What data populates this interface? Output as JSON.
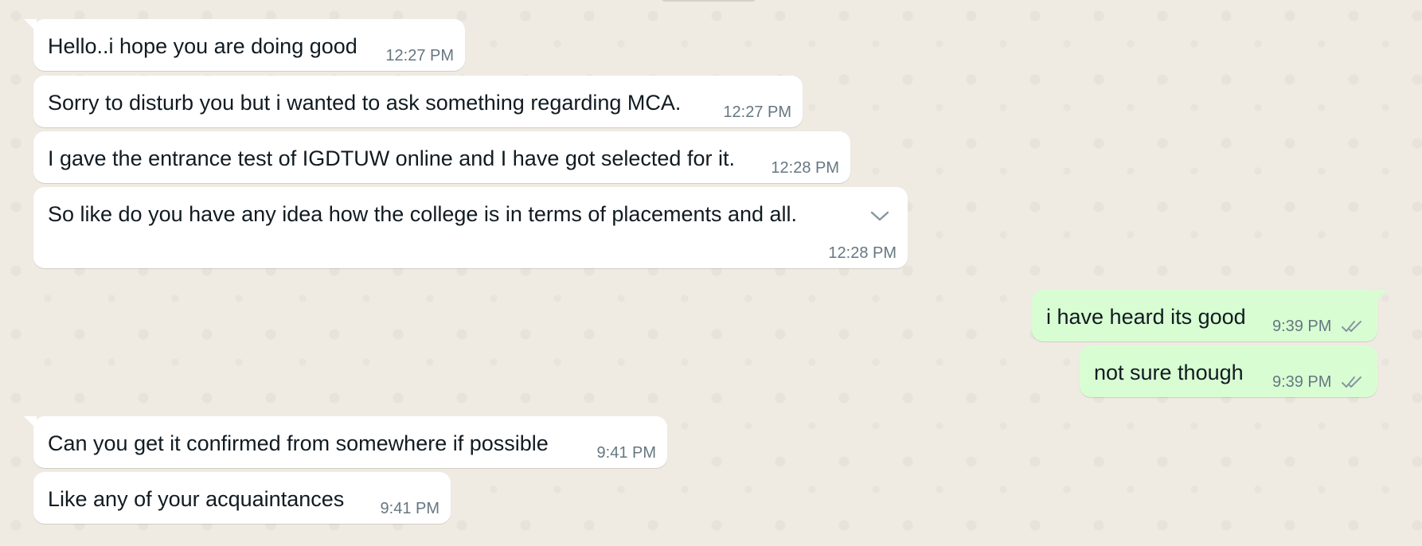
{
  "messages": [
    {
      "direction": "incoming",
      "text": "Hello..i hope you are doing good",
      "time": "12:27 PM"
    },
    {
      "direction": "incoming",
      "text": "Sorry to disturb you but i wanted to ask something regarding MCA.",
      "time": "12:27 PM"
    },
    {
      "direction": "incoming",
      "text": "I gave the entrance test of IGDTUW online and I have got selected for it.",
      "time": "12:28 PM"
    },
    {
      "direction": "incoming",
      "text": "So like do you have any idea how the college is in terms of placements and all.",
      "time": "12:28 PM",
      "menu_icon": "chevron-down-icon"
    },
    {
      "direction": "outgoing",
      "text": "i have heard its good",
      "time": "9:39 PM",
      "status_icon": "double-check-icon"
    },
    {
      "direction": "outgoing",
      "text": "not sure though",
      "time": "9:39 PM",
      "status_icon": "double-check-icon"
    },
    {
      "direction": "incoming",
      "text": "Can you get it confirmed from somewhere if possible",
      "time": "9:41 PM"
    },
    {
      "direction": "incoming",
      "text": "Like any of your acquaintances",
      "time": "9:41 PM"
    }
  ],
  "colors": {
    "background": "#efeae2",
    "incoming_bubble": "#ffffff",
    "outgoing_bubble": "#d9fdd3",
    "timestamp": "#667781",
    "text": "#111b21"
  }
}
